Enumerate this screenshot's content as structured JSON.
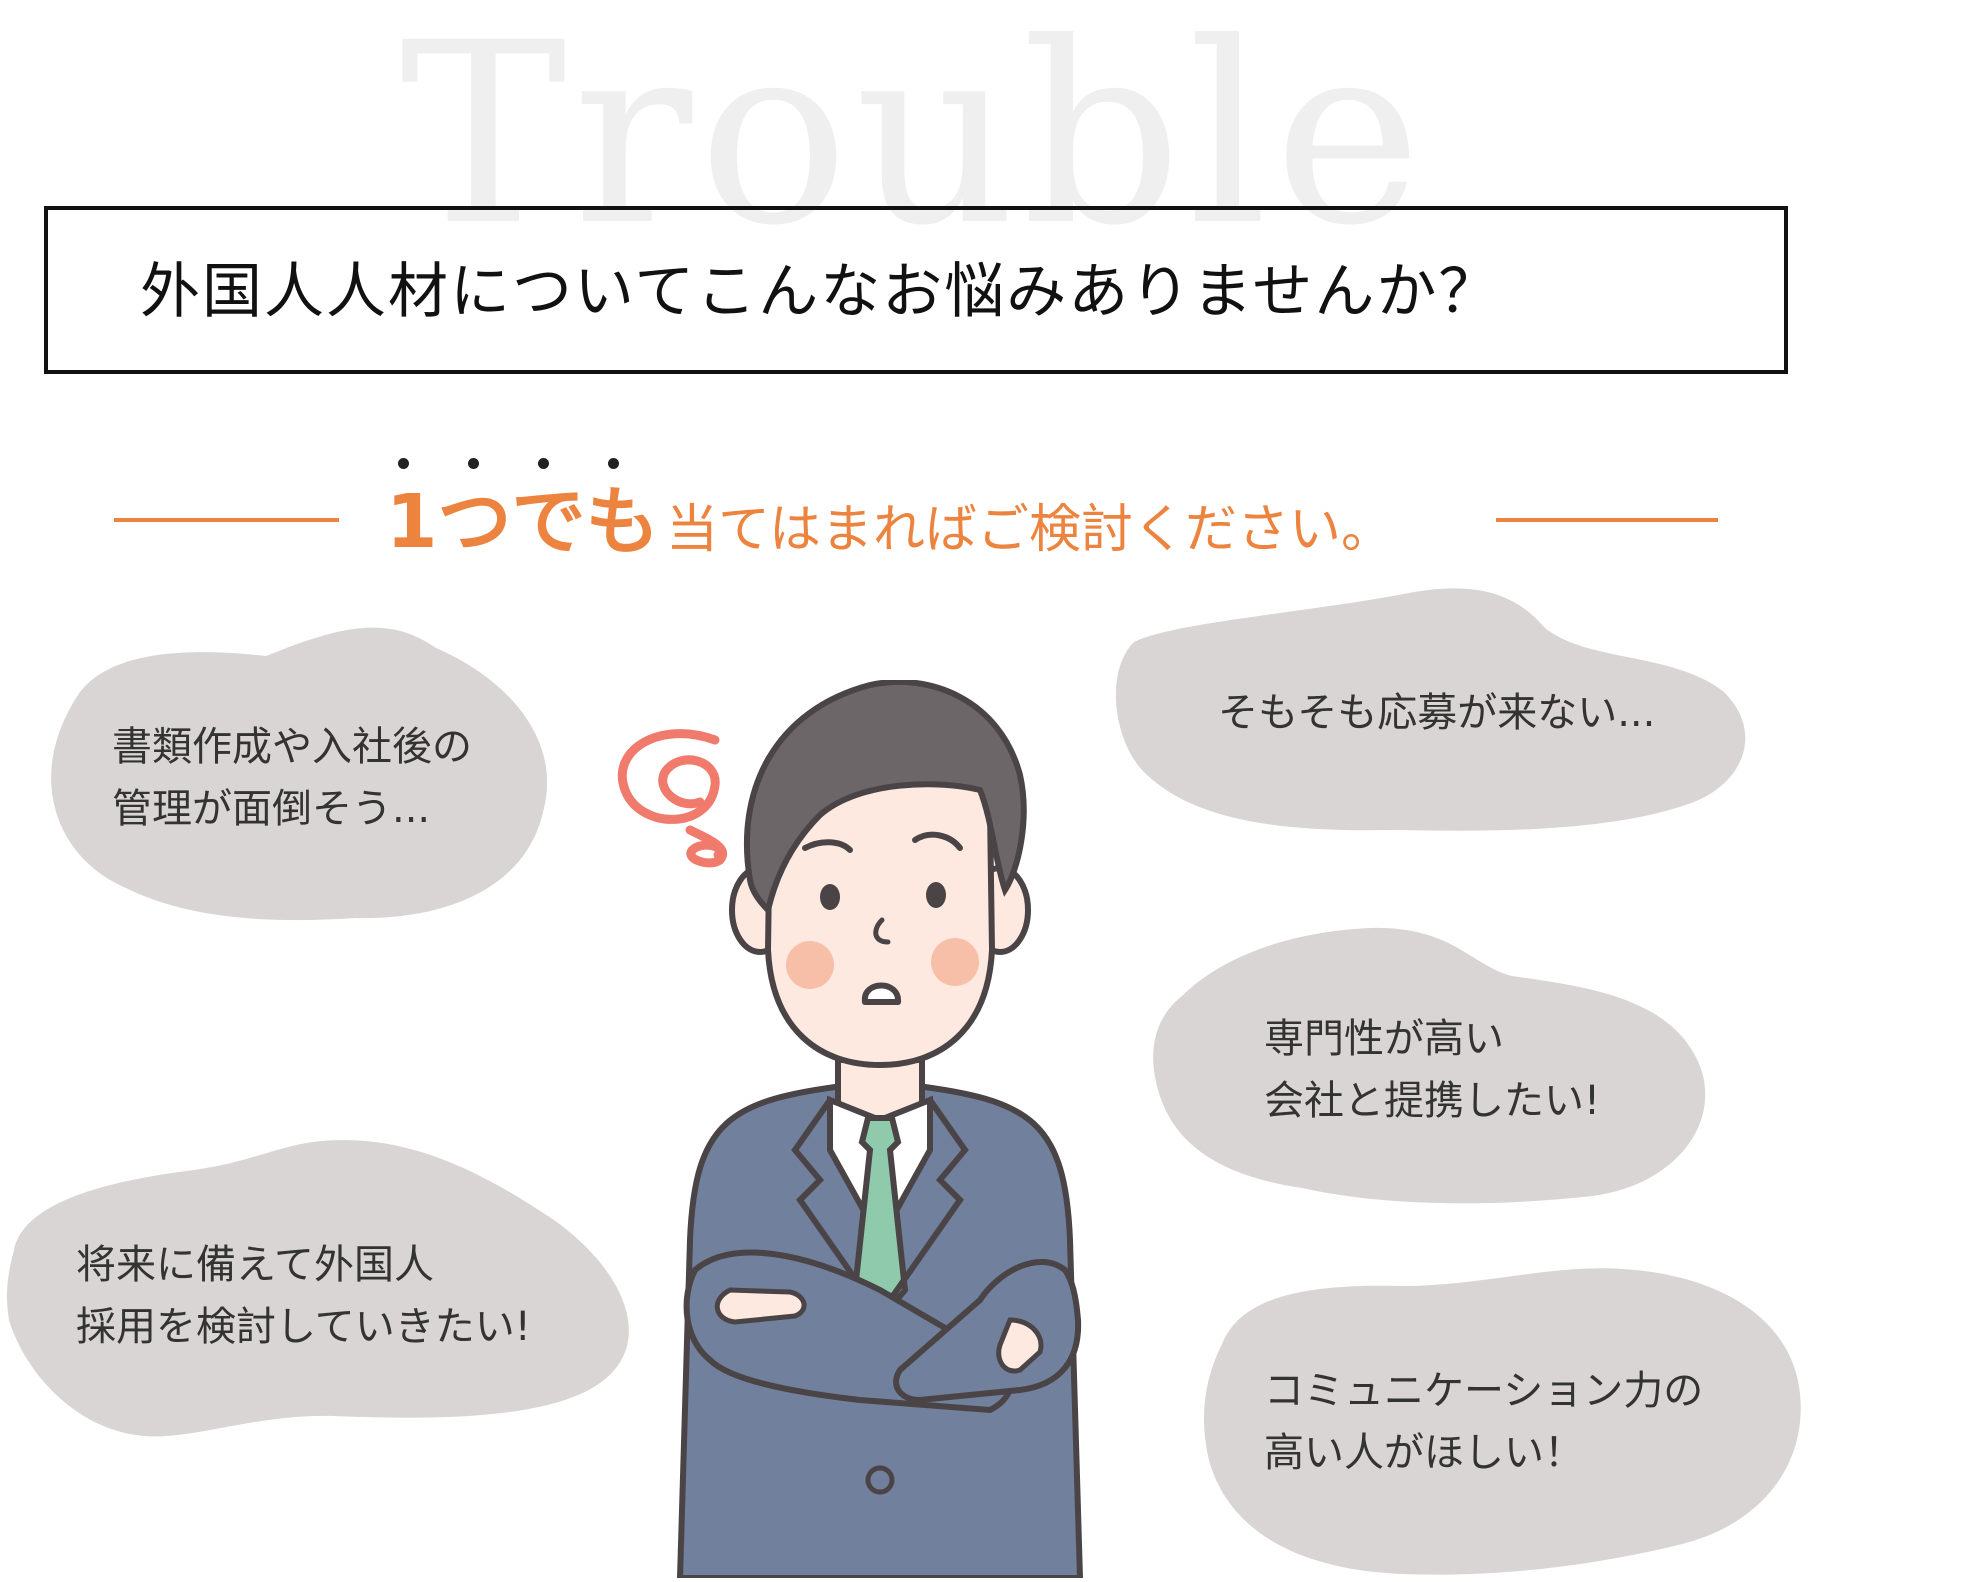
{
  "watermark": "Trouble",
  "headline": "外国人人材についてこんなお悩みありませんか？",
  "subline": {
    "emphasis": "1つでも",
    "rest": "当てはまればご検討ください。"
  },
  "bubbles": [
    {
      "line1": "書類作成や入社後の",
      "line2": "管理が面倒そう..."
    },
    {
      "line1": "そもそも応募が来ない...",
      "line2": ""
    },
    {
      "line1": "専門性が高い",
      "line2": "会社と提携したい!"
    },
    {
      "line1": "将来に備えて外国人",
      "line2": "採用を検討していきたい!"
    },
    {
      "line1": "コミュニケーション力の",
      "line2": "高い人がほしい！"
    }
  ],
  "colors": {
    "accent": "#ec8440",
    "bubble": "#d9d5d4",
    "suit": "#71809c",
    "hair": "#6c6669",
    "tie": "#8fcaad",
    "skin": "#fde9df",
    "swirl": "#f07a6c"
  },
  "icons": {
    "figure": "worried-businessman-illustration",
    "swirl": "confusion-swirl-icon"
  }
}
